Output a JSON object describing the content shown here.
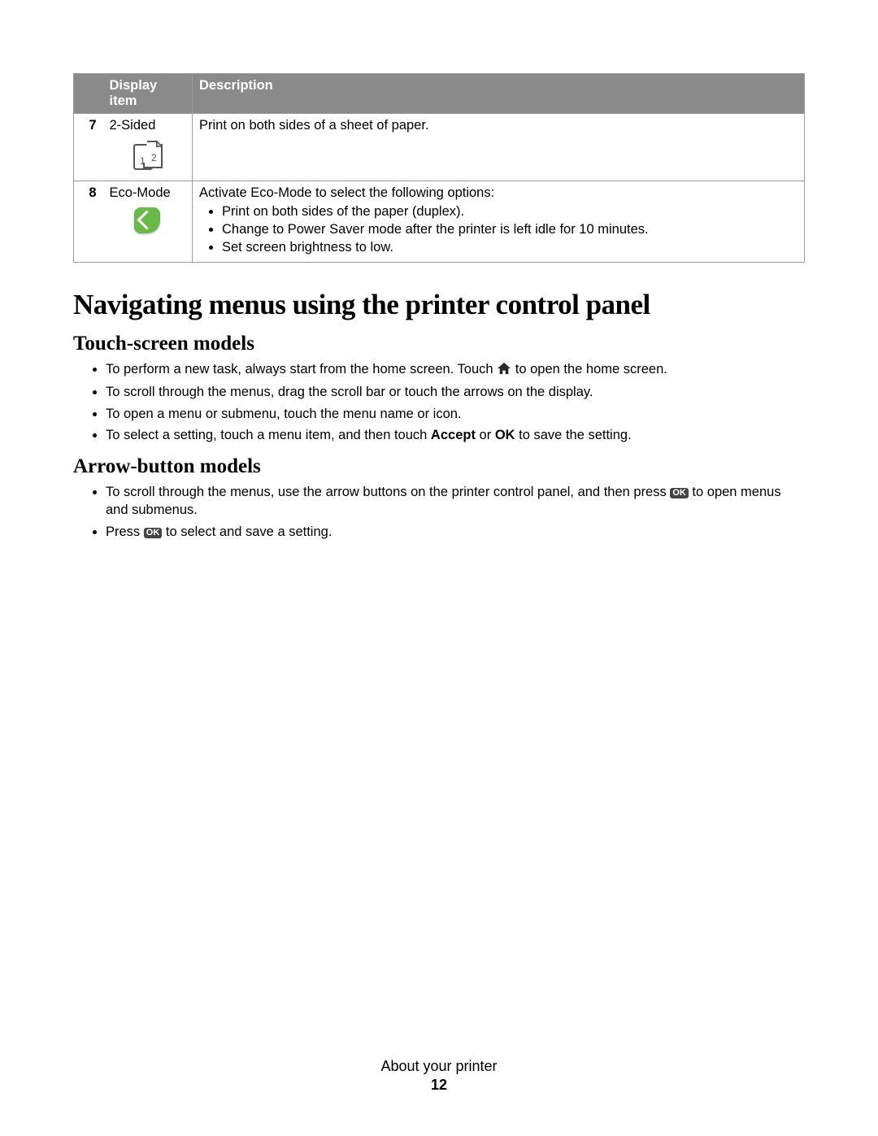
{
  "table": {
    "header_num_item": "Display item",
    "header_desc": "Description",
    "rows": [
      {
        "num": "7",
        "name": "2-Sided",
        "icon": "duplex-icon",
        "desc": "Print on both sides of a sheet of paper."
      },
      {
        "num": "8",
        "name": "Eco-Mode",
        "icon": "eco-icon",
        "desc": "Activate Eco-Mode to select the following options:",
        "bullets": [
          "Print on both sides of the paper (duplex).",
          "Change to Power Saver mode after the printer is left idle for 10 minutes.",
          "Set screen brightness to low."
        ]
      }
    ]
  },
  "heading1": "Navigating menus using the printer control panel",
  "section1": {
    "title": "Touch-screen models",
    "items": {
      "i1_pre": "To perform a new task, always start from the home screen. Touch ",
      "i1_post": " to open the home screen.",
      "i2": "To scroll through the menus, drag the scroll bar or touch the arrows on the display.",
      "i3": "To open a menu or submenu, touch the menu name or icon.",
      "i4_pre": "To select a setting, touch a menu item, and then touch ",
      "i4_b1": "Accept",
      "i4_mid": " or ",
      "i4_b2": "OK",
      "i4_post": " to save the setting."
    }
  },
  "section2": {
    "title": "Arrow-button models",
    "items": {
      "i1_pre": "To scroll through the menus, use the arrow buttons on the printer control panel, and then press ",
      "i1_post": " to open menus and submenus.",
      "i2_pre": "Press ",
      "i2_post": " to select and save a setting."
    }
  },
  "ok_badge": "OK",
  "footer": {
    "section": "About your printer",
    "page": "12"
  }
}
